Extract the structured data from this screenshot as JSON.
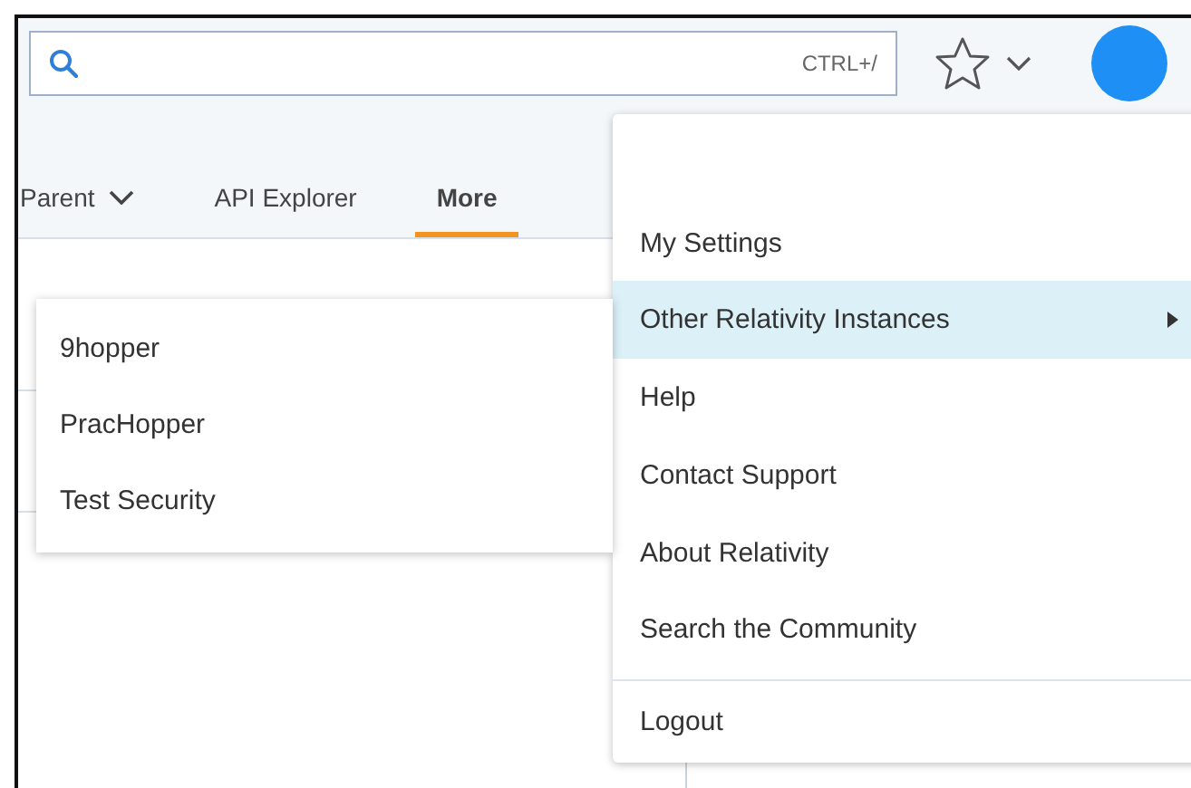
{
  "search": {
    "shortcut": "CTRL+/"
  },
  "nav": {
    "items": [
      {
        "label": "Parent",
        "kind": "dropdown",
        "selected": false
      },
      {
        "label": "API Explorer",
        "kind": "link",
        "selected": false
      },
      {
        "label": "More",
        "kind": "link",
        "selected": true
      }
    ]
  },
  "user_menu": {
    "items": [
      {
        "label": "My Settings",
        "kind": "item",
        "selected": false,
        "divider_before": false
      },
      {
        "label": "Other Relativity Instances",
        "kind": "submenu",
        "selected": true,
        "divider_before": false
      },
      {
        "label": "Help",
        "kind": "item",
        "selected": false,
        "divider_before": false
      },
      {
        "label": "Contact Support",
        "kind": "item",
        "selected": false,
        "divider_before": false
      },
      {
        "label": "About Relativity",
        "kind": "item",
        "selected": false,
        "divider_before": false
      },
      {
        "label": "Search the Community",
        "kind": "item",
        "selected": false,
        "divider_before": false
      },
      {
        "label": "Logout",
        "kind": "item",
        "selected": false,
        "divider_before": true
      }
    ]
  },
  "submenu": {
    "items": [
      {
        "label": "9hopper"
      },
      {
        "label": "PracHopper"
      },
      {
        "label": "Test Security"
      }
    ]
  }
}
